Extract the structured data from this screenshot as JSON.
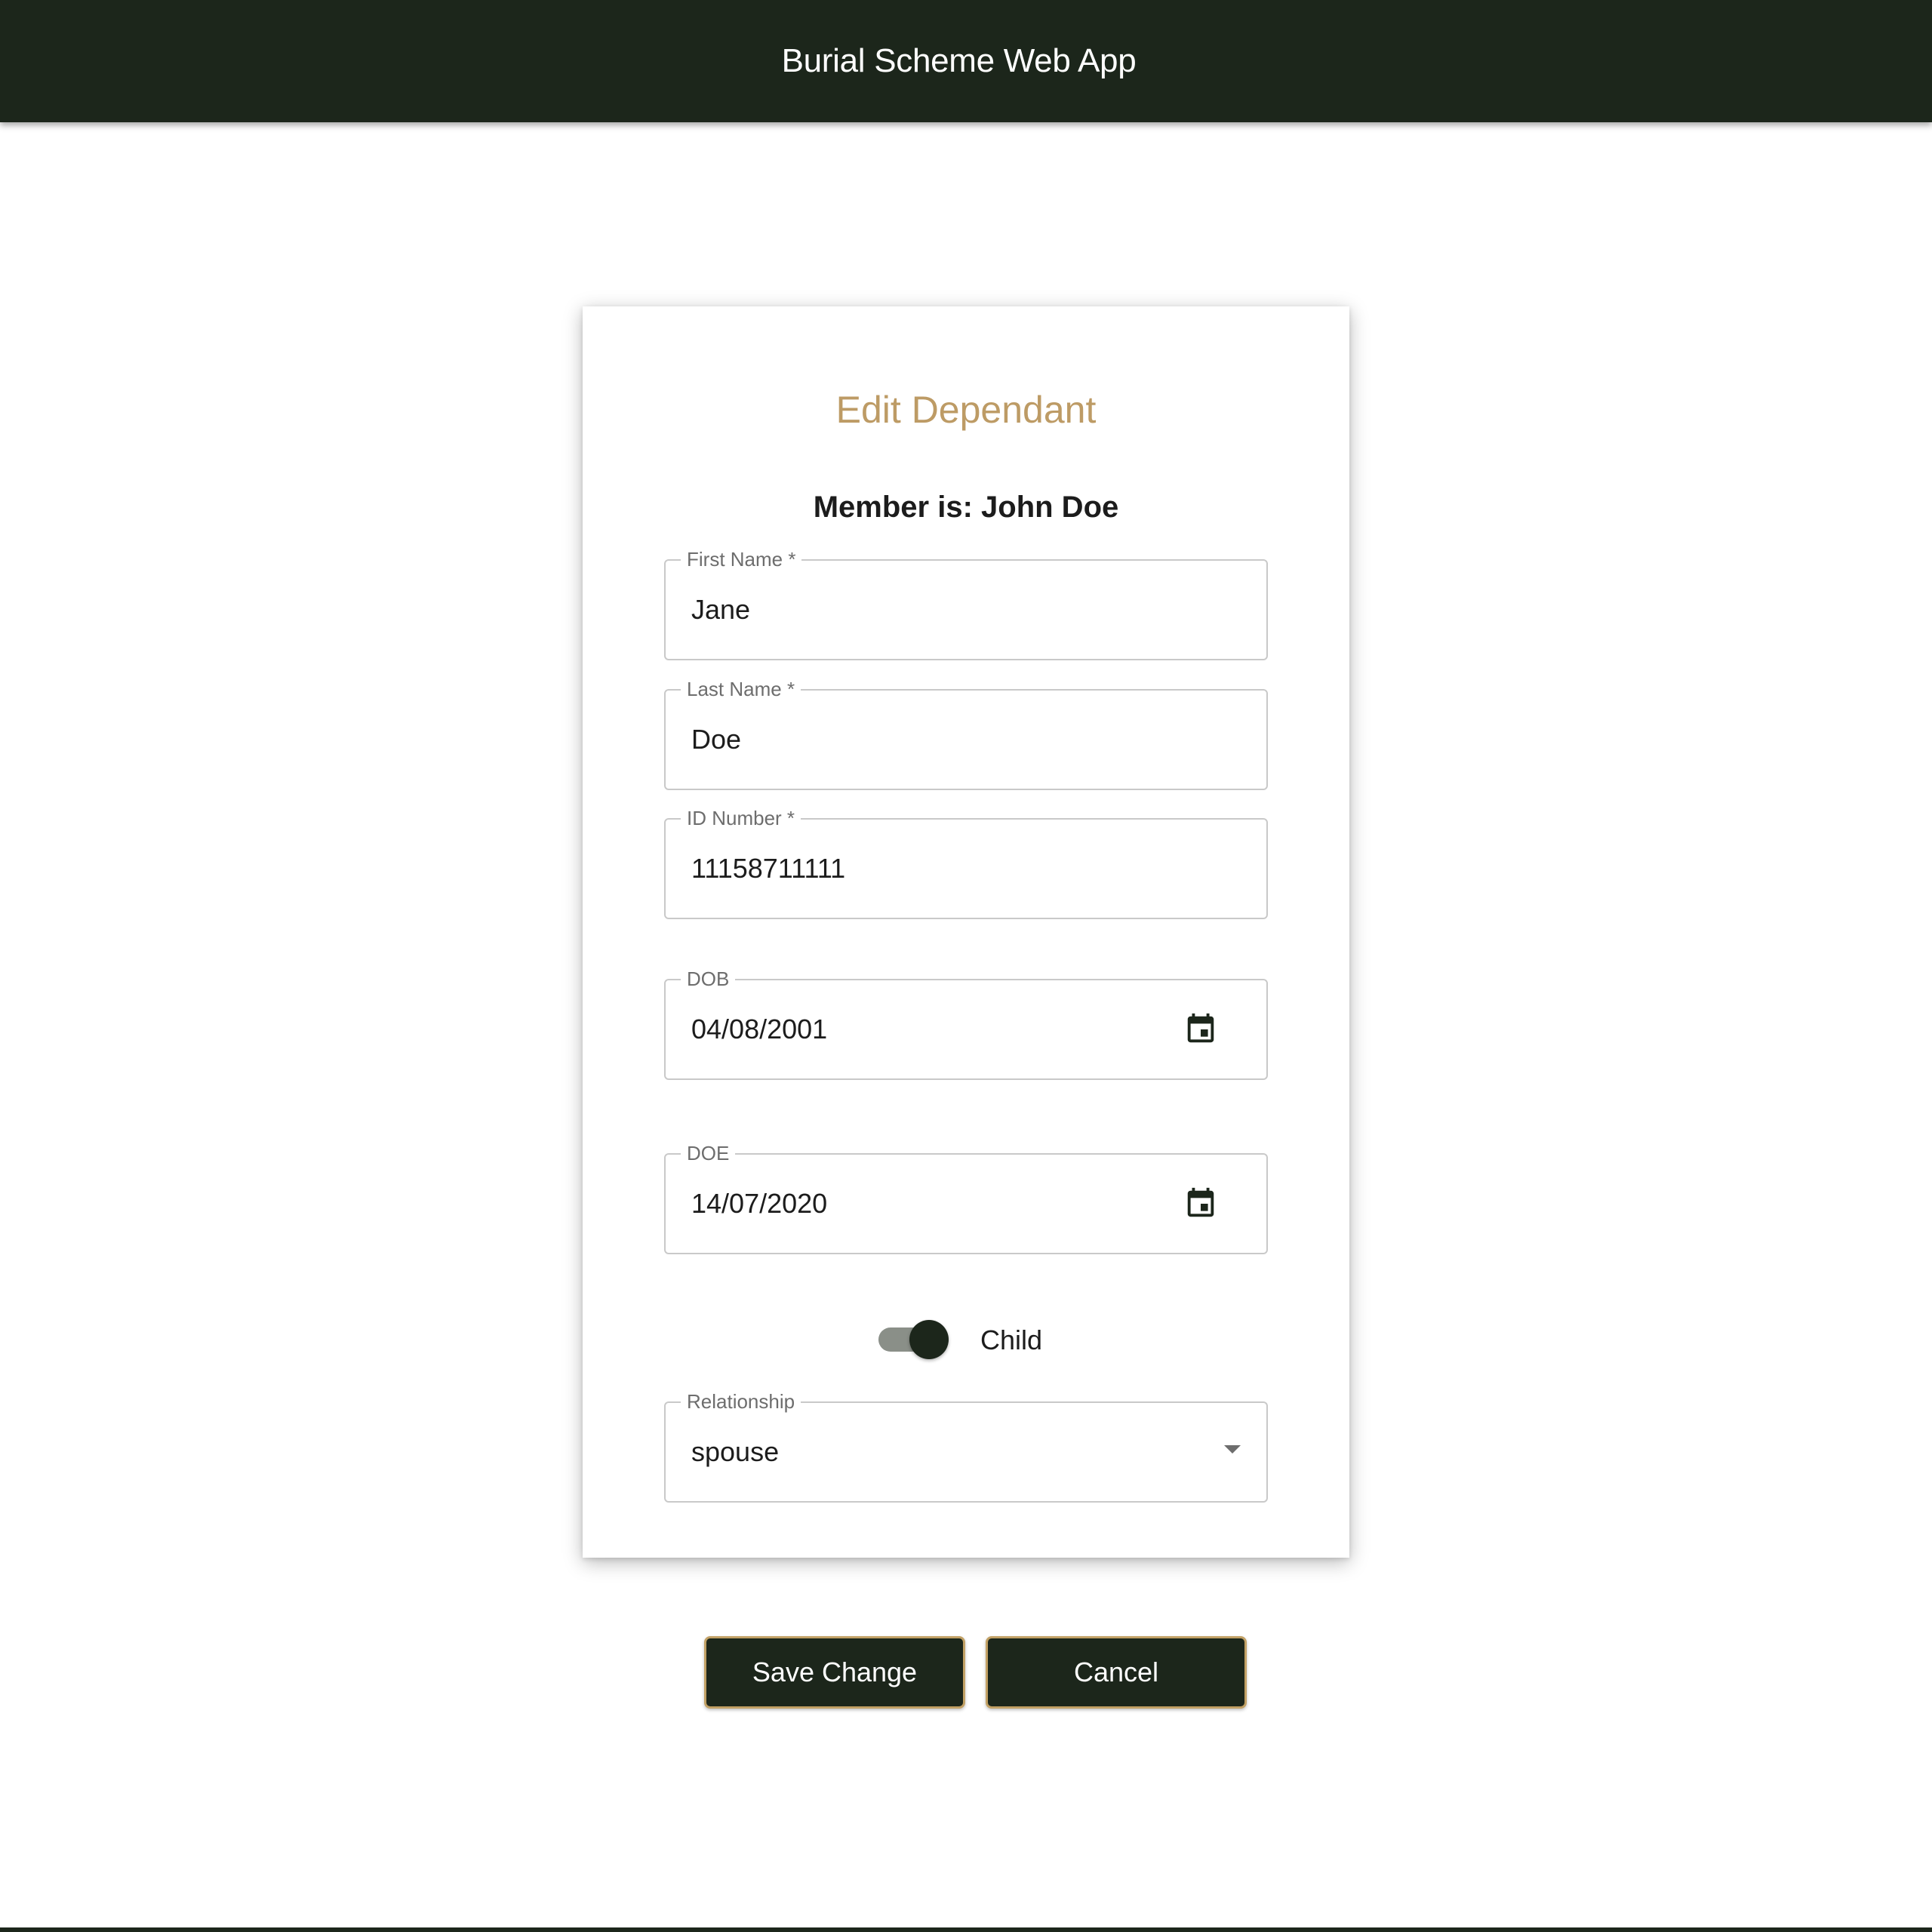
{
  "header": {
    "title": "Burial Scheme Web App"
  },
  "form": {
    "title": "Edit Dependant",
    "member_line": "Member is: John Doe",
    "fields": {
      "first_name": {
        "label": "First Name *",
        "value": "Jane"
      },
      "last_name": {
        "label": "Last Name *",
        "value": "Doe"
      },
      "id_number": {
        "label": "ID Number *",
        "value": "11158711111"
      },
      "dob": {
        "label": "DOB",
        "value": "04/08/2001",
        "icon": "calendar-icon"
      },
      "doe": {
        "label": "DOE",
        "value": "14/07/2020",
        "icon": "calendar-icon"
      },
      "relationship": {
        "label": "Relationship",
        "value": "spouse",
        "icon": "dropdown-arrow-icon"
      }
    },
    "child_toggle": {
      "label": "Child",
      "checked": true
    }
  },
  "actions": {
    "save_label": "Save Change",
    "cancel_label": "Cancel"
  },
  "colors": {
    "primary_dark": "#1c261b",
    "accent_gold": "#bd9b65",
    "border_gray": "#c9c9c9"
  }
}
